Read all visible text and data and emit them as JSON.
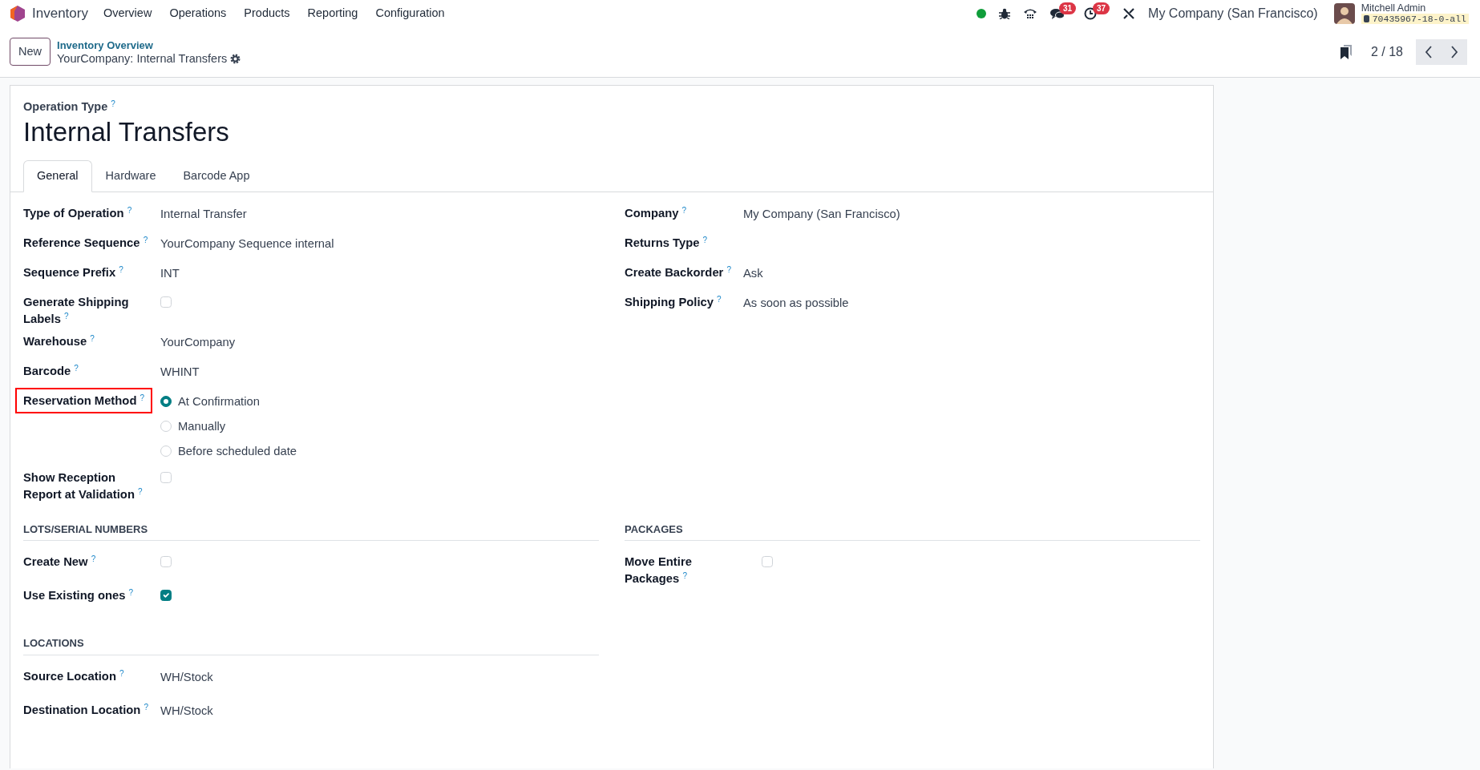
{
  "app": {
    "name": "Inventory"
  },
  "menu": [
    "Overview",
    "Operations",
    "Products",
    "Reporting",
    "Configuration"
  ],
  "systray": {
    "online": true,
    "chat_count": "31",
    "activity_count": "37",
    "company": "My Company (San Francisco)",
    "user": "Mitchell Admin",
    "database": "70435967-18-0-all"
  },
  "control_panel": {
    "new_button": "New",
    "breadcrumb": "Inventory Overview",
    "record": "YourCompany: Internal Transfers",
    "pager": "2 / 18"
  },
  "form": {
    "overline": "Operation Type $^{?}$",
    "title": "Internal Transfers",
    "tabs": [
      {
        "label": "General",
        "selected": true
      },
      {
        "label": "Hardware",
        "selected": false
      },
      {
        "label": "Barcode App",
        "selected": false
      }
    ],
    "left_fields": [
      {
        "kind": "text",
        "label": "Type of Operation $^{?}$",
        "value": "Internal Transfer",
        "highlighted": false
      },
      {
        "kind": "text",
        "label": "Reference Sequence $^{?}$",
        "value": "YourCompany Sequence internal",
        "highlighted": false
      },
      {
        "kind": "text",
        "label": "Sequence Prefix $^{?}$",
        "value": "INT",
        "highlighted": false
      },
      {
        "kind": "checkbox",
        "label": "Generate Shipping Labels $^{?}$",
        "checked": false,
        "highlighted": false
      },
      {
        "kind": "text",
        "label": "Warehouse $^{?}$",
        "value": "YourCompany",
        "highlighted": false
      },
      {
        "kind": "text",
        "label": "Barcode $^{?}$",
        "value": "WHINT",
        "highlighted": false
      },
      {
        "kind": "radio",
        "label": "Reservation Method $^{?}$",
        "highlighted": true,
        "options": [
          {
            "label": "At Confirmation",
            "selected": true
          },
          {
            "label": "Manually",
            "selected": false
          },
          {
            "label": "Before scheduled date",
            "selected": false
          }
        ]
      },
      {
        "kind": "checkbox",
        "label": "Show Reception Report at Validation $^{?}$",
        "checked": false,
        "highlighted": false
      }
    ],
    "right_fields": [
      {
        "kind": "text",
        "label": "Company $^{?}$",
        "value": "My Company (San Francisco)"
      },
      {
        "kind": "text",
        "label": "Returns Type $^{?}$"
      },
      {
        "kind": "text",
        "label": "Create Backorder $^{?}$",
        "value": "Ask"
      },
      {
        "kind": "text",
        "label": "Shipping Policy $^{?}$",
        "value": "As soon as possible"
      }
    ],
    "lower_left": [
      {
        "title": "LOTS/SERIAL NUMBERS",
        "fields": [
          {
            "kind": "checkbox",
            "label": "Create New $^{?}$",
            "checked": false
          },
          {
            "kind": "checkbox",
            "label": "Use Existing ones $^{?}$",
            "checked": true
          }
        ]
      },
      {
        "title": "LOCATIONS",
        "fields": [
          {
            "kind": "text",
            "label": "Source Location $^{?}$",
            "value": "WH/Stock"
          },
          {
            "kind": "text",
            "label": "Destination Location $^{?}$",
            "value": "WH/Stock"
          }
        ]
      }
    ],
    "lower_right": [
      {
        "title": "PACKAGES",
        "fields": [
          {
            "kind": "checkbox",
            "label": "Move Entire Packages $^{?}$",
            "checked": false
          }
        ]
      }
    ]
  }
}
